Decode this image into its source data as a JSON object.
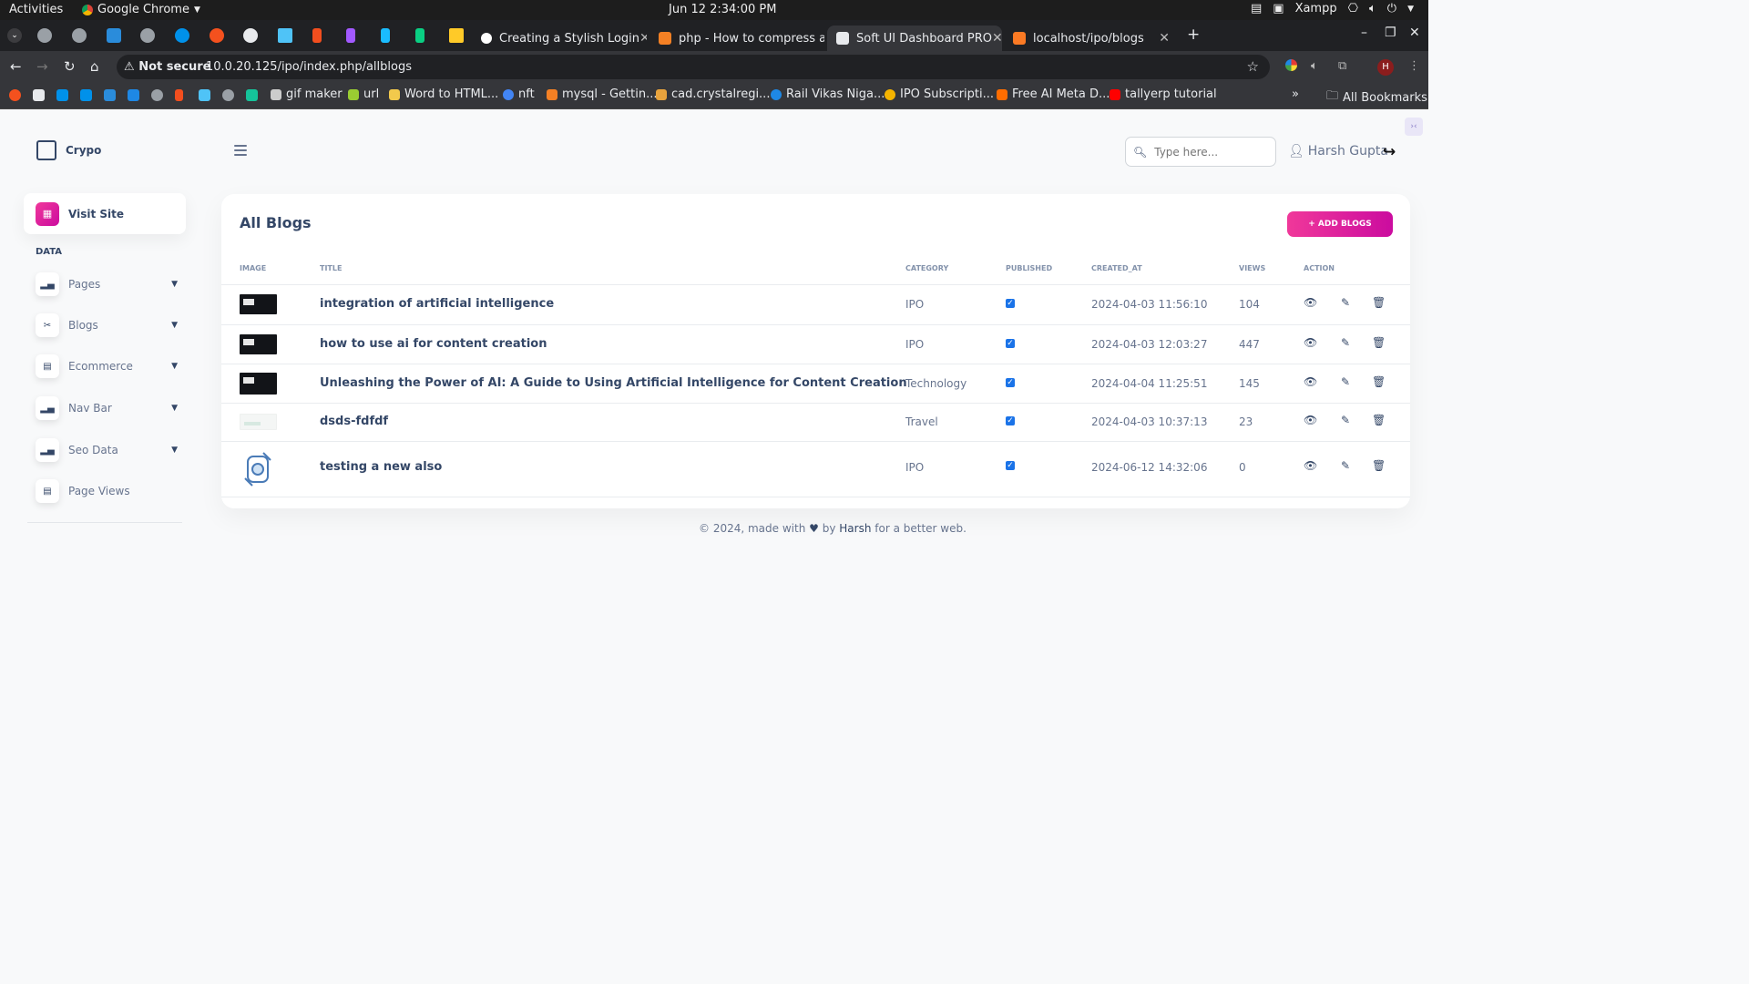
{
  "os": {
    "activities": "Activities",
    "app_name": "Google Chrome",
    "clock": "Jun 12  2:34:00 PM",
    "tray_label": "Xampp"
  },
  "tabs": [
    {
      "title": "Creating a Stylish Login",
      "color": "#2b2b2b"
    },
    {
      "title": "php - How to compress a",
      "color": "#f48024"
    },
    {
      "title": "Soft UI Dashboard PRO",
      "color": "#e8eaed",
      "active": true
    },
    {
      "title": "localhost/ipo/blogs",
      "color": "#fb7a24"
    }
  ],
  "address": {
    "security": "Not secure",
    "url": "10.0.20.125/ipo/index.php/allblogs"
  },
  "bookmarks": [
    {
      "label": "gif maker",
      "color": "#cccccc"
    },
    {
      "label": "url",
      "color": "#9acd32"
    },
    {
      "label": "Word to HTML...",
      "color": "#f2c94c"
    },
    {
      "label": "nft",
      "color": "#4285f4"
    },
    {
      "label": "mysql - Gettin...",
      "color": "#f48024"
    },
    {
      "label": "cad.crystalregi...",
      "color": "#e8a33d"
    },
    {
      "label": "Rail Vikas Niga...",
      "color": "#1e88e5"
    },
    {
      "label": "IPO Subscripti...",
      "color": "#f4b400"
    },
    {
      "label": "Free AI Meta D...",
      "color": "#ff6d00"
    },
    {
      "label": "tallyerp tutorial",
      "color": "#ff0000"
    }
  ],
  "all_bookmarks": "All Bookmarks",
  "sidebar": {
    "brand": "Crypo",
    "visit_site": "Visit Site",
    "section": "DATA",
    "items": [
      {
        "label": "Pages",
        "has_children": true
      },
      {
        "label": "Blogs",
        "has_children": true
      },
      {
        "label": "Ecommerce",
        "has_children": true
      },
      {
        "label": "Nav Bar",
        "has_children": true
      },
      {
        "label": "Seo Data",
        "has_children": true
      },
      {
        "label": "Page Views",
        "has_children": false
      }
    ]
  },
  "header": {
    "search_placeholder": "Type here...",
    "user_name": "Harsh Gupta"
  },
  "main": {
    "title": "All Blogs",
    "add_button": "+ ADD BLOGS",
    "columns": [
      "IMAGE",
      "TITLE",
      "CATEGORY",
      "PUBLISHED",
      "CREATED_AT",
      "VIEWS",
      "ACTION"
    ],
    "rows": [
      {
        "title": "integration of artificial intelligence",
        "category": "IPO",
        "published": true,
        "created_at": "2024-04-03 11:56:10",
        "views": "104",
        "thumb": "dark"
      },
      {
        "title": "how to use ai for content creation",
        "category": "IPO",
        "published": true,
        "created_at": "2024-04-03 12:03:27",
        "views": "447",
        "thumb": "dark"
      },
      {
        "title": "Unleashing the Power of AI: A Guide to Using Artificial Intelligence for Content Creation",
        "category": "Technology",
        "published": true,
        "created_at": "2024-04-04 11:25:51",
        "views": "145",
        "thumb": "dark"
      },
      {
        "title": "dsds-fdfdf",
        "category": "Travel",
        "published": true,
        "created_at": "2024-04-03 10:37:13",
        "views": "23",
        "thumb": "light"
      },
      {
        "title": "testing a new also",
        "category": "IPO",
        "published": true,
        "created_at": "2024-06-12 14:32:06",
        "views": "0",
        "thumb": "robot"
      }
    ]
  },
  "footer": {
    "prefix": "© 2024, made with",
    "by": "by",
    "author": "Harsh",
    "suffix": "for a better web."
  },
  "colors": {
    "accent": "#cb0c9f",
    "text_dark": "#344767",
    "text_muted": "#67748e"
  }
}
